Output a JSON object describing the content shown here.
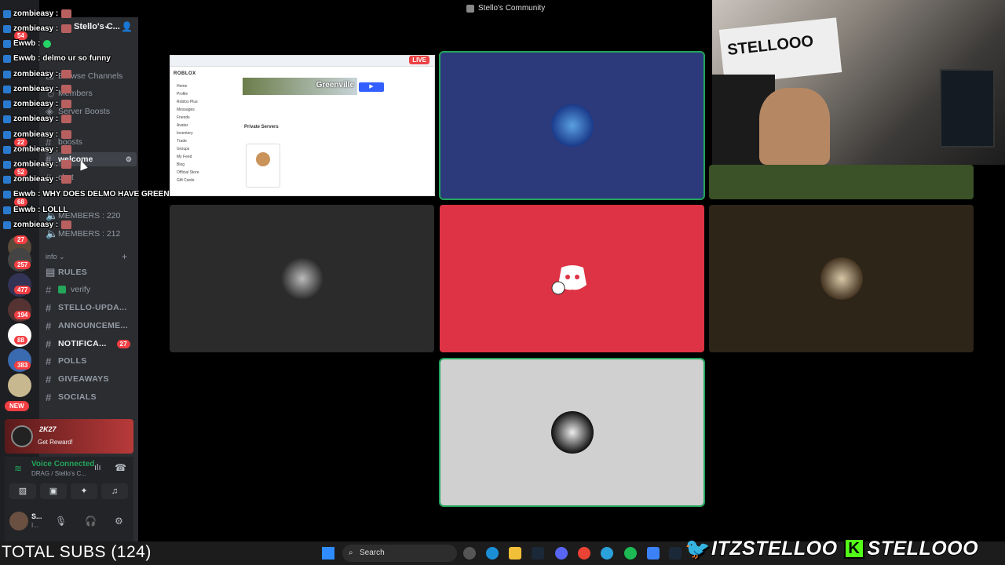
{
  "window": {
    "title": "Stello's Community"
  },
  "server": {
    "name": "Stello's C..."
  },
  "channels": [
    {
      "label": "Browse Channels",
      "type": "browse"
    },
    {
      "label": "Members",
      "type": "members"
    },
    {
      "label": "Server Boosts",
      "type": "boosts"
    },
    {
      "label": "boosts",
      "type": "text"
    },
    {
      "label": "welcome",
      "type": "text"
    },
    {
      "label": "chat",
      "type": "text"
    },
    {
      "label": "MEMBERS : 220",
      "type": "stat"
    },
    {
      "label": "MEMBERS : 212",
      "type": "stat"
    }
  ],
  "info_category": {
    "name": "info",
    "channels": [
      {
        "label": "RULES",
        "bold": false,
        "count": ""
      },
      {
        "label": "verify",
        "bold": false,
        "count": ""
      },
      {
        "label": "STELLO-UPDA...",
        "bold": false,
        "count": ""
      },
      {
        "label": "ANNOUNCEME...",
        "bold": false,
        "count": ""
      },
      {
        "label": "NOTIFICA...",
        "bold": true,
        "count": "27"
      },
      {
        "label": "POLLS",
        "bold": false,
        "count": ""
      },
      {
        "label": "GIVEAWAYS",
        "bold": false,
        "count": ""
      },
      {
        "label": "SOCIALS",
        "bold": false,
        "count": ""
      }
    ]
  },
  "server_rail": {
    "badges": [
      "54",
      "22",
      "52",
      "68",
      "27",
      "257",
      "477",
      "194",
      "88",
      "383"
    ],
    "new_label": "NEW"
  },
  "promo": {
    "game": "2K27",
    "cta": "Get Reward!"
  },
  "voice_panel": {
    "status": "Voice Connected",
    "channel": "DRAG / Stello's C..."
  },
  "user_panel": {
    "name": "S...",
    "status": "I..."
  },
  "chat_overlay": [
    {
      "user": "zombieasy",
      "text": ""
    },
    {
      "user": "zombieasy",
      "text": ""
    },
    {
      "user": "Ewwb",
      "text": ""
    },
    {
      "user": "Ewwb",
      "text": "delmo ur so funny"
    },
    {
      "user": "zombieasy",
      "text": ""
    },
    {
      "user": "zombieasy",
      "text": ""
    },
    {
      "user": "zombieasy",
      "text": ""
    },
    {
      "user": "zombieasy",
      "text": ""
    },
    {
      "user": "zombieasy",
      "text": ""
    },
    {
      "user": "zombieasy",
      "text": ""
    },
    {
      "user": "zombieasy",
      "text": ""
    },
    {
      "user": "zombieasy",
      "text": ""
    },
    {
      "user": "Ewwb",
      "text": "WHY DOES DELMO HAVE GREENVILLE THERE"
    },
    {
      "user": "Ewwb",
      "text": "LOLLL"
    },
    {
      "user": "zombieasy",
      "text": ""
    }
  ],
  "screen_share": {
    "live_label": "LIVE",
    "site_logo": "ROBLOX",
    "game_title": "Greenville",
    "section": "Private Servers",
    "nav": [
      "Home",
      "Profile",
      "Roblox Plus",
      "Messages",
      "Friends",
      "Avatar",
      "Inventory",
      "Trade",
      "Groups",
      "My Feed",
      "Blog",
      "Official Store",
      "Gift Cards"
    ]
  },
  "tiles": [
    {
      "id": "screen-share",
      "bg": "#ffffff"
    },
    {
      "id": "user-blue",
      "bg": "#2c3a7c",
      "speaking": true
    },
    {
      "id": "user-webcam-bottom",
      "bg": "#3b5127"
    },
    {
      "id": "user-dark",
      "bg": "#2b2b2b"
    },
    {
      "id": "user-red",
      "bg": "#dd3344"
    },
    {
      "id": "user-brown",
      "bg": "#2e2519"
    },
    {
      "id": "user-grey",
      "bg": "#d0d0d0",
      "speaking": true
    }
  ],
  "webcam": {
    "sign_text": "STELLOOO"
  },
  "taskbar": {
    "search_placeholder": "Search",
    "subs_text": "TOTAL SUBS (124)"
  },
  "branding": {
    "twitter_handle": "ITZSTELLOO",
    "kick_handle": "STELLOOO",
    "kick_letter": "K"
  },
  "colors": {
    "discord_green": "#23a55a",
    "discord_red": "#f23f43",
    "kick_green": "#53fc18",
    "twitter_blue": "#1d9bf0"
  }
}
